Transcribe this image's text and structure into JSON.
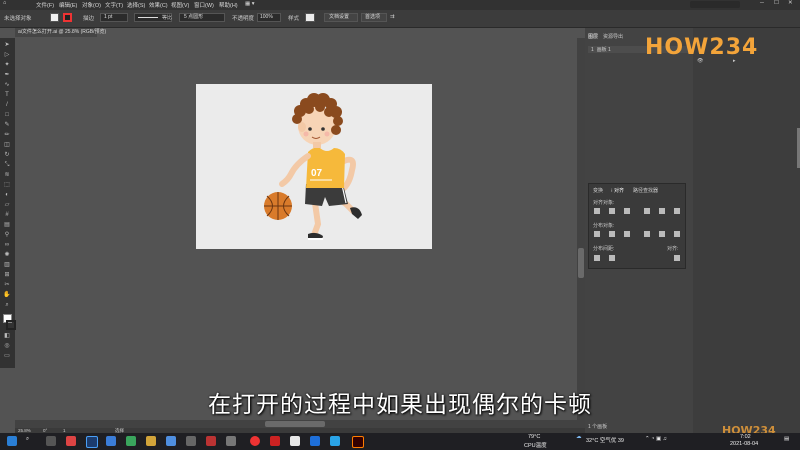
{
  "menu": [
    "文件(F)",
    "编辑(E)",
    "对象(O)",
    "文字(T)",
    "选择(S)",
    "效果(C)",
    "视图(V)",
    "窗口(W)",
    "帮助(H)"
  ],
  "control": {
    "selection_label": "未选择对象",
    "stroke_label": "描边",
    "stroke_value": "1 pt",
    "uniform_label": "等比",
    "brush_label": "5 点圆形",
    "opacity_label": "不透明度",
    "opacity_value": "100%",
    "style_label": "样式",
    "doc_setup_button": "文档设置",
    "prefs_button": "首选项"
  },
  "doc_tab": "ai文件怎么打开.ai @ 25.8% (RGB/预览)",
  "panels": {
    "layers_tab": "图层",
    "export_tab": "资源导出",
    "artboard_item": "画板 1",
    "transform_tab": "变换",
    "align_tab": "对齐",
    "pathfinder_tab": "路径查找器",
    "align_objects_label": "对齐对象:",
    "distribute_objects_label": "分布对象:",
    "distribute_spacing_label": "分布间距:",
    "align_to_label": "对齐:"
  },
  "status": {
    "zoom": "25.8%",
    "rotation": "0°",
    "artboard_num": "1",
    "tool_name": "选择",
    "artboard_count": "1 个画板"
  },
  "caption": "在打开的过程中如果出现偶尔的卡顿",
  "taskbar": {
    "cpu_temp": "79°C",
    "cpu_label": "CPU温度",
    "weather": "32°C 空气优 39",
    "time": "7:02",
    "date": "2021-08-04"
  },
  "player_jersey": "07",
  "watermark": "HOW234",
  "colors": {
    "menubar": "#323232",
    "canvas": "#535353",
    "artboard": "#ebebeb",
    "jersey": "#f6b93b",
    "basketball": "#d97b2b",
    "hair": "#8a4a1e",
    "taskbar": "#1f1f23"
  }
}
